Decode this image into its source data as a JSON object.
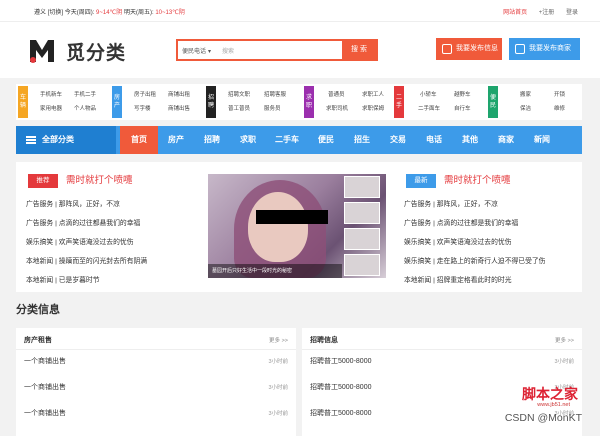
{
  "topbar": {
    "city": "遵义",
    "switch": "[切换]",
    "today": "今天(周四):",
    "today_temp": "9~14℃阴",
    "tomorrow": "明天(周五):",
    "tomorrow_temp": "10~13℃阴",
    "link_home": "网站首页",
    "link_register": "+注册",
    "link_login": "登录"
  },
  "header": {
    "logo_text": "觅分类",
    "search_category": "便民电话",
    "search_placeholder": "搜索",
    "search_button": "搜 索",
    "post_info": "我要发布信息",
    "post_shop": "我要发布商家"
  },
  "categories": [
    {
      "tag": "车辆",
      "color": "#f5a623",
      "items": [
        "手机新车",
        "手机二手",
        "家用电器",
        "个人物品"
      ]
    },
    {
      "tag": "房产",
      "color": "#3d9be9",
      "items": [
        "房子出租",
        "商铺出租",
        "写字楼",
        "商铺出售"
      ]
    },
    {
      "tag": "招聘",
      "color": "#222222",
      "items": [
        "招聘文职",
        "招聘客服",
        "普工普员",
        "服务员"
      ]
    },
    {
      "tag": "求职",
      "color": "#9b2fae",
      "items": [
        "普通员",
        "求职工人",
        "求职司机",
        "求职保姆"
      ]
    },
    {
      "tag": "二手",
      "color": "#e4393c",
      "items": [
        "小轿车",
        "越野车",
        "二手面车",
        "自行车"
      ]
    },
    {
      "tag": "便民",
      "color": "#1ea56d",
      "items": [
        "搬家",
        "开锁",
        "保洁",
        "维修"
      ]
    }
  ],
  "nav": {
    "all_label": "全部分类",
    "items": [
      "首页",
      "房产",
      "招聘",
      "求职",
      "二手车",
      "便民",
      "招生",
      "交易",
      "电话",
      "其他",
      "商家",
      "新闻"
    ]
  },
  "news_left": {
    "label": "推荐",
    "title": "需时就打个喷嚏",
    "rows": [
      "广告服务 | 那阵风，正好，不凉",
      "广告服务 | 点滴的过往都悬我们的幸福",
      "娱乐搞笑 | 欢声笑语淹没过去的忧伤",
      "本地新闻 | 操躏而至的闪光封去所有阴满",
      "本地新闻 | 已是岁暮时节"
    ]
  },
  "news_right": {
    "label": "最新",
    "title": "需时就打个喷嚏",
    "rows": [
      "广告服务 | 那阵风，正好，不凉",
      "广告服务 | 点滴的过往都是我们的幸福",
      "娱乐搞笑 | 欢声笑语淹没过去的忧伤",
      "娱乐搞笑 | 走在路上的新奇行人迫不得已受了伤",
      "本地新闻 | 招牌重定格看此时的时光"
    ]
  },
  "photo_caption": "墓园开后只好生活中一段时光的秘密",
  "section_title": "分类信息",
  "panels": [
    {
      "title": "房产租售",
      "more": "更多 >>",
      "rows": [
        {
          "text": "一个商铺出售",
          "date": "3小时前"
        },
        {
          "text": "一个商铺出售",
          "date": "3小时前"
        },
        {
          "text": "一个商铺出售",
          "date": "3小时前"
        }
      ]
    },
    {
      "title": "招聘信息",
      "more": "更多 >>",
      "rows": [
        {
          "text": "招聘普工5000-8000",
          "date": "3小时前"
        },
        {
          "text": "招聘普工5000-8000",
          "date": "3小时前"
        },
        {
          "text": "招聘普工5000-8000",
          "date": "3小时前"
        }
      ]
    }
  ],
  "watermark": {
    "site": "脚本之家",
    "url": "www.jb51.net",
    "csdn": "CSDN @MonKT"
  },
  "colors": {
    "brand_orange": "#f05a3a",
    "brand_blue": "#3d9be9",
    "nav_dark": "#1f7fd1"
  }
}
